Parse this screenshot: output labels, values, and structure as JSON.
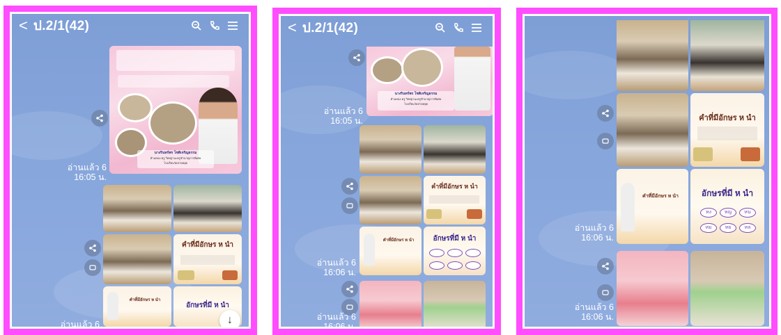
{
  "header": {
    "back_label": "<",
    "chat_title": "ป.2/1(42)"
  },
  "icons": {
    "search": "search-icon",
    "call": "phone-icon",
    "menu": "menu-icon",
    "share": "share-icon",
    "save": "save-icon",
    "scroll": "arrow-down-icon"
  },
  "messages": {
    "read_6": "อ่านแล้ว 6",
    "time_1605": "16:05 น.",
    "time_1606": "16:06 น.",
    "read_6_cut": "อ่านแล้ว 6"
  },
  "cards": {
    "card_title": "คำที่มีอักษร ห นำ",
    "letters_title": "อักษรที่มี ห นำ",
    "chip_a": "หง",
    "chip_b": "หญ",
    "chip_c": "หน",
    "chip_d": "หม",
    "chip_e": "หย",
    "chip_f": "หล"
  },
  "poster": {
    "teacher_name": "นางรินทร์พร โชติเจริญธรรม",
    "teacher_role": "ตำแหน่ง ครู วิทยฐานะครูชำนาญการพิเศษ",
    "school": "โรงเรียนวัดสายหยุด"
  },
  "scroll_label": "↓",
  "colors": {
    "frame": "#ff4dff",
    "chat_bg": "#86a6dc"
  }
}
